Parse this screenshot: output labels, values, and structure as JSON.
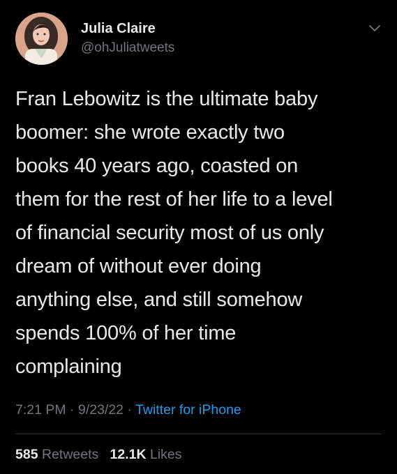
{
  "user": {
    "display_name": "Julia Claire",
    "handle": "@ohJuliatweets",
    "avatar_icon": "avatar"
  },
  "tweet": {
    "text_lines": [
      "Fran Lebowitz is the ultimate baby",
      "boomer: she wrote exactly two",
      "books 40 years ago, coasted on",
      "them for the rest of her life to a level",
      "of financial security most of us only",
      "dream of without ever doing",
      "anything else, and still somehow",
      "spends 100% of her time",
      "complaining"
    ]
  },
  "meta": {
    "time": "7:21 PM",
    "date": "9/23/22",
    "separator": "·",
    "source": "Twitter for iPhone"
  },
  "stats": {
    "retweets_count": "585",
    "retweets_label": "Retweets",
    "likes_count": "12.1K",
    "likes_label": "Likes"
  },
  "colors": {
    "background": "#000000",
    "text": "#e7e9ea",
    "secondary": "#71767b",
    "link": "#1d9bf0"
  }
}
